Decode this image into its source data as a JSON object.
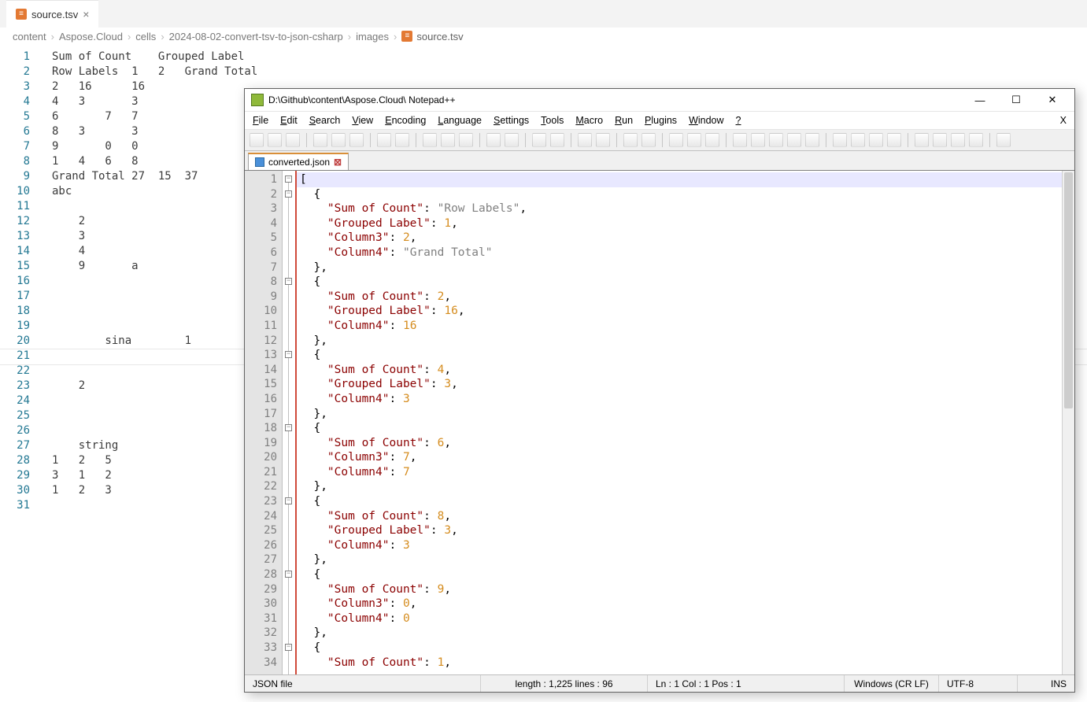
{
  "vscode": {
    "tab_name": "source.tsv",
    "breadcrumbs": [
      "content",
      "Aspose.Cloud",
      "cells",
      "2024-08-02-convert-tsv-to-json-csharp",
      "images",
      "source.tsv"
    ],
    "lines": [
      "Sum of Count    Grouped Label",
      "Row Labels  1   2   Grand Total",
      "2   16      16",
      "4   3       3",
      "6       7   7",
      "8   3       3",
      "9       0   0",
      "1   4   6   8",
      "Grand Total 27  15  37",
      "abc",
      "",
      "    2",
      "    3",
      "    4",
      "    9       a",
      "",
      "",
      "",
      "",
      "        sina        1",
      "",
      "",
      "    2",
      "",
      "",
      "",
      "    string",
      "1   2   5",
      "3   1   2",
      "1   2   3",
      ""
    ],
    "highlight_line_index": 20
  },
  "notepadpp": {
    "title": "D:\\Github\\content\\Aspose.Cloud\\ Notepad++",
    "menu": [
      "File",
      "Edit",
      "Search",
      "View",
      "Encoding",
      "Language",
      "Settings",
      "Tools",
      "Macro",
      "Run",
      "Plugins",
      "Window",
      "?"
    ],
    "doc_tab": "converted.json",
    "code_tokens": [
      [
        [
          "p",
          "["
        ]
      ],
      [
        [
          "p",
          "  {"
        ]
      ],
      [
        [
          "p",
          "    "
        ],
        [
          "k",
          "\"Sum of Count\""
        ],
        [
          "p",
          ": "
        ],
        [
          "s",
          "\"Row Labels\""
        ],
        [
          "p",
          ","
        ]
      ],
      [
        [
          "p",
          "    "
        ],
        [
          "k",
          "\"Grouped Label\""
        ],
        [
          "p",
          ": "
        ],
        [
          "n",
          "1"
        ],
        [
          "p",
          ","
        ]
      ],
      [
        [
          "p",
          "    "
        ],
        [
          "k",
          "\"Column3\""
        ],
        [
          "p",
          ": "
        ],
        [
          "n",
          "2"
        ],
        [
          "p",
          ","
        ]
      ],
      [
        [
          "p",
          "    "
        ],
        [
          "k",
          "\"Column4\""
        ],
        [
          "p",
          ": "
        ],
        [
          "s",
          "\"Grand Total\""
        ]
      ],
      [
        [
          "p",
          "  },"
        ]
      ],
      [
        [
          "p",
          "  {"
        ]
      ],
      [
        [
          "p",
          "    "
        ],
        [
          "k",
          "\"Sum of Count\""
        ],
        [
          "p",
          ": "
        ],
        [
          "n",
          "2"
        ],
        [
          "p",
          ","
        ]
      ],
      [
        [
          "p",
          "    "
        ],
        [
          "k",
          "\"Grouped Label\""
        ],
        [
          "p",
          ": "
        ],
        [
          "n",
          "16"
        ],
        [
          "p",
          ","
        ]
      ],
      [
        [
          "p",
          "    "
        ],
        [
          "k",
          "\"Column4\""
        ],
        [
          "p",
          ": "
        ],
        [
          "n",
          "16"
        ]
      ],
      [
        [
          "p",
          "  },"
        ]
      ],
      [
        [
          "p",
          "  {"
        ]
      ],
      [
        [
          "p",
          "    "
        ],
        [
          "k",
          "\"Sum of Count\""
        ],
        [
          "p",
          ": "
        ],
        [
          "n",
          "4"
        ],
        [
          "p",
          ","
        ]
      ],
      [
        [
          "p",
          "    "
        ],
        [
          "k",
          "\"Grouped Label\""
        ],
        [
          "p",
          ": "
        ],
        [
          "n",
          "3"
        ],
        [
          "p",
          ","
        ]
      ],
      [
        [
          "p",
          "    "
        ],
        [
          "k",
          "\"Column4\""
        ],
        [
          "p",
          ": "
        ],
        [
          "n",
          "3"
        ]
      ],
      [
        [
          "p",
          "  },"
        ]
      ],
      [
        [
          "p",
          "  {"
        ]
      ],
      [
        [
          "p",
          "    "
        ],
        [
          "k",
          "\"Sum of Count\""
        ],
        [
          "p",
          ": "
        ],
        [
          "n",
          "6"
        ],
        [
          "p",
          ","
        ]
      ],
      [
        [
          "p",
          "    "
        ],
        [
          "k",
          "\"Column3\""
        ],
        [
          "p",
          ": "
        ],
        [
          "n",
          "7"
        ],
        [
          "p",
          ","
        ]
      ],
      [
        [
          "p",
          "    "
        ],
        [
          "k",
          "\"Column4\""
        ],
        [
          "p",
          ": "
        ],
        [
          "n",
          "7"
        ]
      ],
      [
        [
          "p",
          "  },"
        ]
      ],
      [
        [
          "p",
          "  {"
        ]
      ],
      [
        [
          "p",
          "    "
        ],
        [
          "k",
          "\"Sum of Count\""
        ],
        [
          "p",
          ": "
        ],
        [
          "n",
          "8"
        ],
        [
          "p",
          ","
        ]
      ],
      [
        [
          "p",
          "    "
        ],
        [
          "k",
          "\"Grouped Label\""
        ],
        [
          "p",
          ": "
        ],
        [
          "n",
          "3"
        ],
        [
          "p",
          ","
        ]
      ],
      [
        [
          "p",
          "    "
        ],
        [
          "k",
          "\"Column4\""
        ],
        [
          "p",
          ": "
        ],
        [
          "n",
          "3"
        ]
      ],
      [
        [
          "p",
          "  },"
        ]
      ],
      [
        [
          "p",
          "  {"
        ]
      ],
      [
        [
          "p",
          "    "
        ],
        [
          "k",
          "\"Sum of Count\""
        ],
        [
          "p",
          ": "
        ],
        [
          "n",
          "9"
        ],
        [
          "p",
          ","
        ]
      ],
      [
        [
          "p",
          "    "
        ],
        [
          "k",
          "\"Column3\""
        ],
        [
          "p",
          ": "
        ],
        [
          "n",
          "0"
        ],
        [
          "p",
          ","
        ]
      ],
      [
        [
          "p",
          "    "
        ],
        [
          "k",
          "\"Column4\""
        ],
        [
          "p",
          ": "
        ],
        [
          "n",
          "0"
        ]
      ],
      [
        [
          "p",
          "  },"
        ]
      ],
      [
        [
          "p",
          "  {"
        ]
      ],
      [
        [
          "p",
          "    "
        ],
        [
          "k",
          "\"Sum of Count\""
        ],
        [
          "p",
          ": "
        ],
        [
          "n",
          "1"
        ],
        [
          "p",
          ","
        ]
      ]
    ],
    "fold_lines": [
      0,
      1,
      7,
      12,
      17,
      22,
      27,
      32
    ],
    "status": {
      "lang": "JSON file",
      "length": "length : 1,225    lines : 96",
      "pos": "Ln : 1    Col : 1    Pos : 1",
      "eol": "Windows (CR LF)",
      "enc": "UTF-8",
      "mode": "INS"
    }
  }
}
